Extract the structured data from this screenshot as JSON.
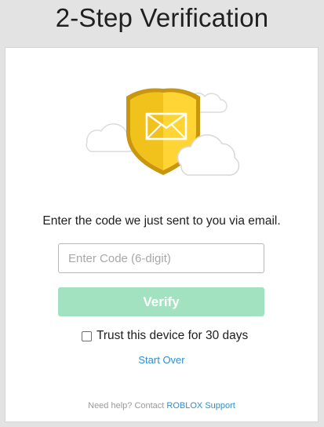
{
  "page": {
    "title": "2-Step Verification"
  },
  "verification": {
    "prompt": "Enter the code we just sent to you via email.",
    "code_placeholder": "Enter Code (6-digit)",
    "code_value": "",
    "verify_label": "Verify",
    "trust_label": "Trust this device for 30 days",
    "trust_checked": false,
    "start_over_label": "Start Over"
  },
  "footer": {
    "help_text": "Need help? Contact",
    "support_link": "ROBLOX Support"
  },
  "icons": {
    "illustration": "shield-envelope-icon",
    "clouds": "cloud-icon"
  },
  "colors": {
    "verify_button": "#a3e2c0",
    "link": "#2a8fd6",
    "shield_gold": "#f2c21c",
    "shield_outline": "#c9960f"
  }
}
